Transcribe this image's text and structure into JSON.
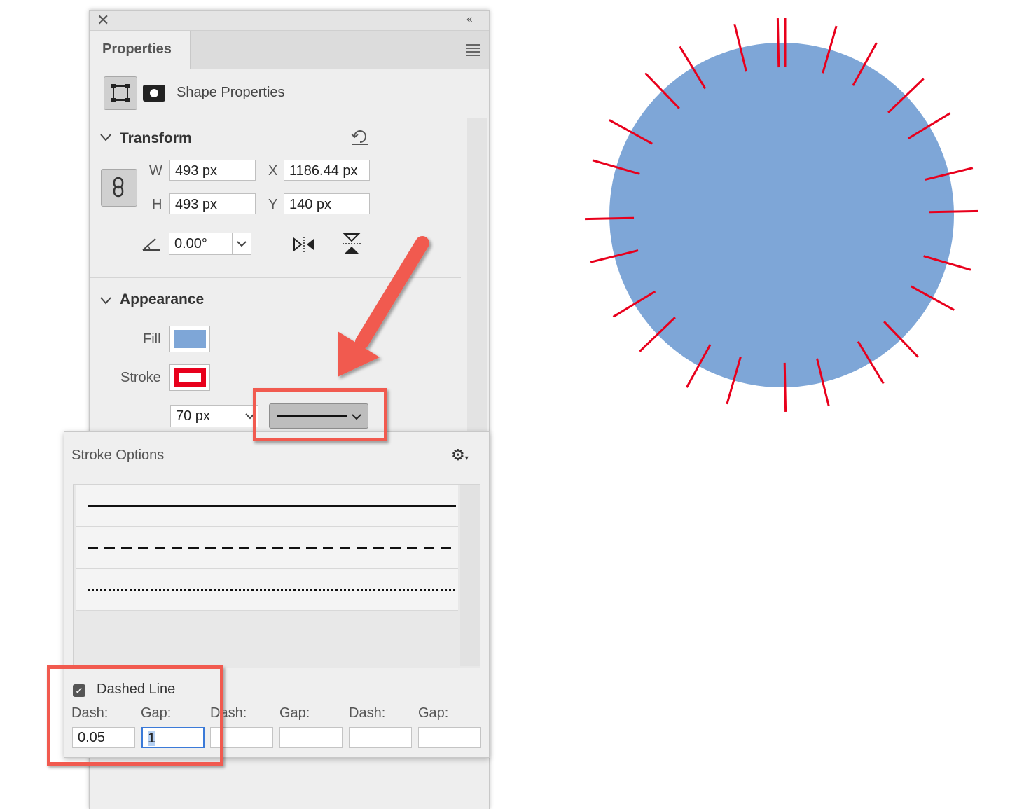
{
  "panel": {
    "tab_label": "Properties",
    "close_icon": "close-icon",
    "collapse_label": "‹‹",
    "menu_icon": "hamburger-menu-icon"
  },
  "shape": {
    "label": "Shape Properties"
  },
  "transform": {
    "title": "Transform",
    "w_label": "W",
    "w_value": "493 px",
    "h_label": "H",
    "h_value": "493 px",
    "x_label": "X",
    "x_value": "1186.44 px",
    "y_label": "Y",
    "y_value": "140 px",
    "rotation_value": "0.00°"
  },
  "appearance": {
    "title": "Appearance",
    "fill_label": "Fill",
    "fill_color": "#7ea6d7",
    "stroke_label": "Stroke",
    "stroke_color": "#e8001c",
    "stroke_width": "70 px"
  },
  "stroke_options": {
    "title": "Stroke Options",
    "styles": [
      "solid",
      "dashed",
      "dotted"
    ],
    "dashed_line_label": "Dashed Line",
    "dashed_line_checked": true,
    "dash_label": "Dash:",
    "gap_label": "Gap:",
    "dash1": "0.05",
    "gap1": "1",
    "dash2": "",
    "gap2": "",
    "dash3": "",
    "gap3": ""
  },
  "canvas": {
    "circle_fill": "#7ea6d7",
    "tick_color": "#e8001c",
    "tick_count": 24
  },
  "annotations": {
    "highlight_color": "#f15a4f"
  }
}
